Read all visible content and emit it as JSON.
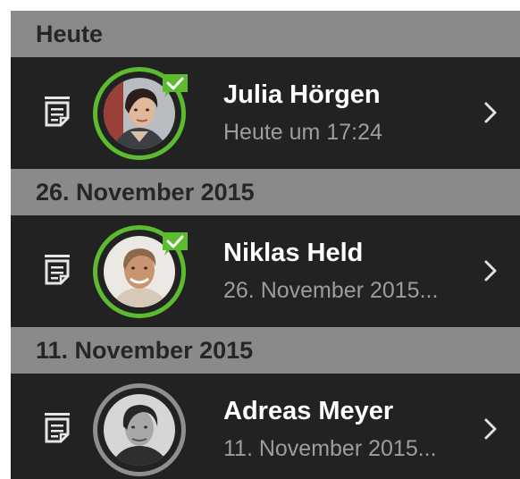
{
  "colors": {
    "section_bg": "#8a8a8a",
    "row_bg": "#222222",
    "accent_green": "#5dbb2f",
    "ring_grey": "#8f8f8f",
    "title_text": "#ffffff",
    "subtitle_text": "#9d9d9d"
  },
  "sections": [
    {
      "header": "Heute",
      "entry": {
        "name": "Julia Hörgen",
        "date": "Heute um 17:24",
        "status": "checked",
        "icons": [
          "document-icon",
          "avatar",
          "check-badge-icon",
          "chevron-right-icon"
        ]
      }
    },
    {
      "header": "26. November 2015",
      "entry": {
        "name": "Niklas Held",
        "date": "26. November 2015...",
        "status": "checked",
        "icons": [
          "document-icon",
          "avatar",
          "check-badge-icon",
          "chevron-right-icon"
        ]
      }
    },
    {
      "header": "11. November 2015",
      "entry": {
        "name": "Adreas Meyer",
        "date": "11. November 2015...",
        "status": "unchecked",
        "icons": [
          "document-icon",
          "avatar",
          "chevron-right-icon"
        ]
      }
    }
  ]
}
